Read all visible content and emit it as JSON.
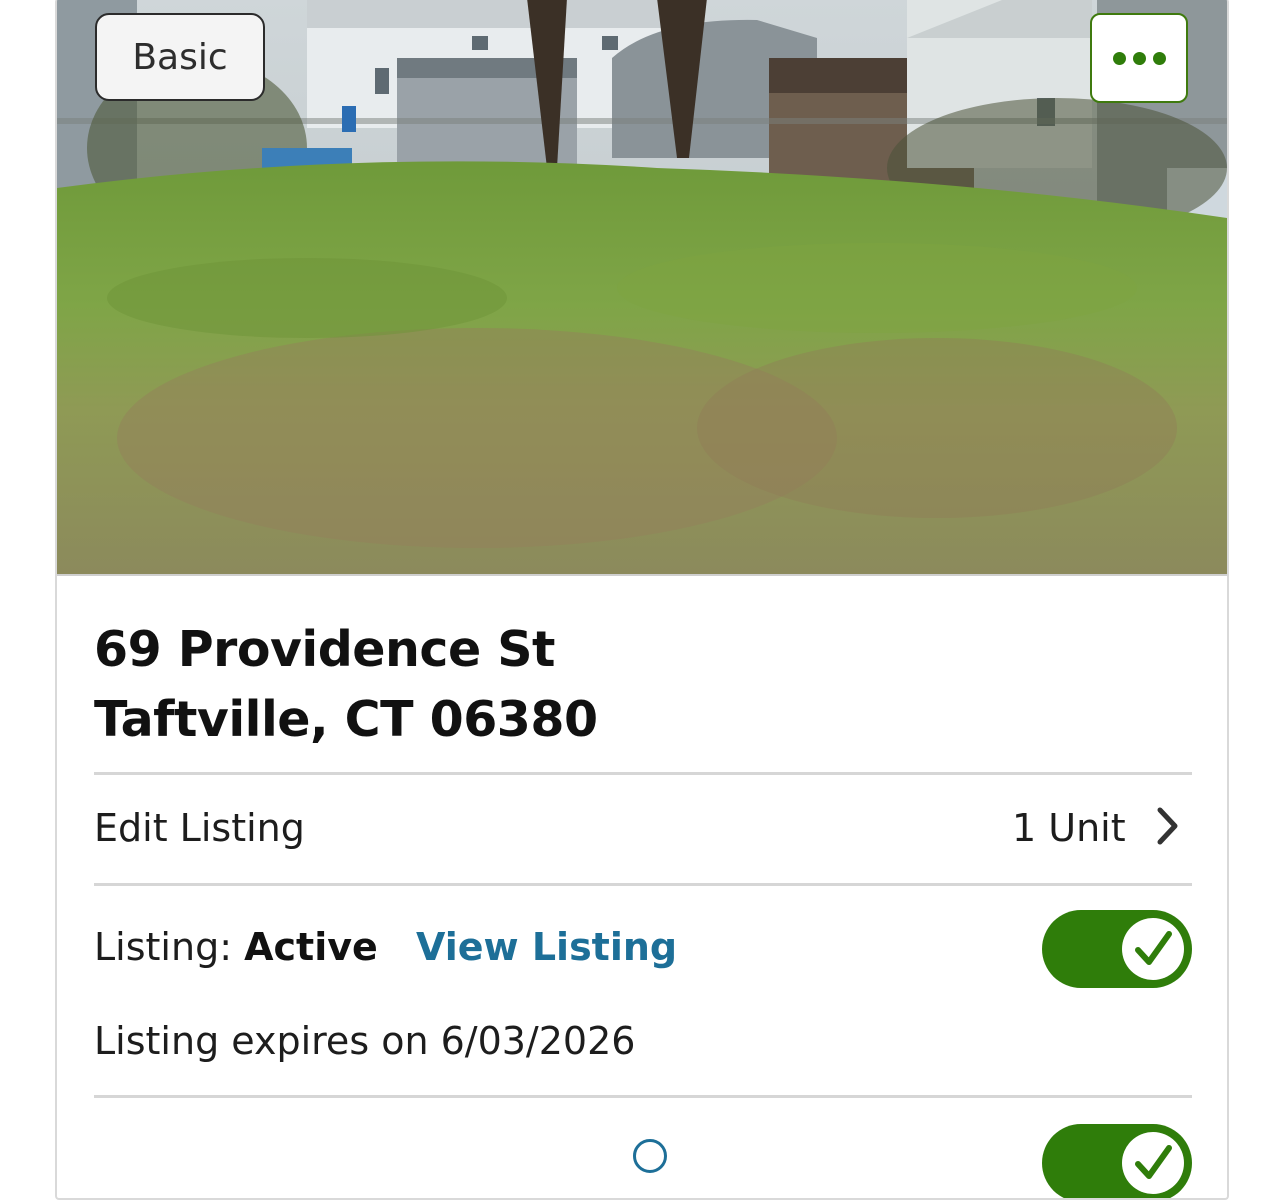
{
  "listing": {
    "badge_label": "Basic",
    "address_line1": "69 Providence St",
    "address_line2": "Taftville, CT 06380"
  },
  "edit_row": {
    "label": "Edit Listing",
    "units": "1 Unit"
  },
  "status_row": {
    "label": "Listing:",
    "status": "Active",
    "view_link": "View Listing",
    "toggle_on": true,
    "expires": "Listing expires on 6/03/2026"
  },
  "next_row": {
    "toggle_on": true
  },
  "colors": {
    "accent_green": "#2f7d0a",
    "link_blue": "#1d6f98"
  },
  "icons": {
    "more": "more-horizontal-icon",
    "chevron": "chevron-right-icon",
    "check": "checkmark-icon",
    "info": "info-icon"
  }
}
